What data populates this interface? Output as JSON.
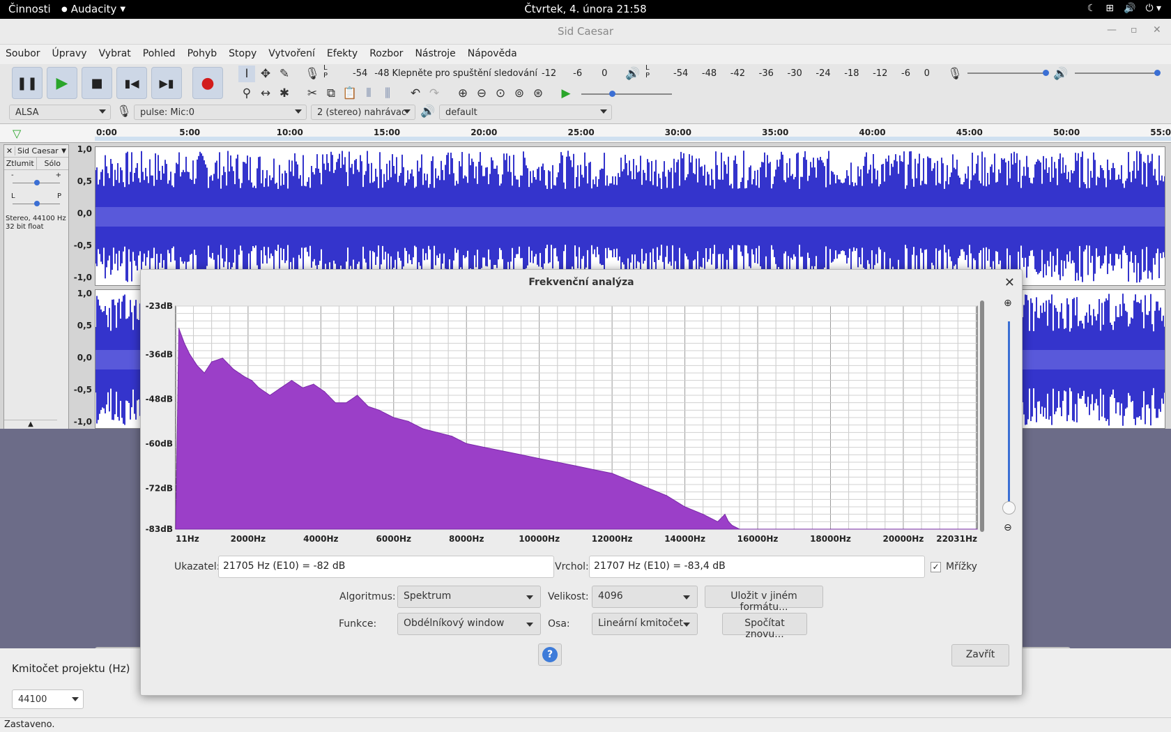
{
  "system": {
    "activities": "Činnosti",
    "app_menu": "Audacity",
    "clock": "Čtvrtek, 4. února  21:58"
  },
  "window": {
    "title": "Sid Caesar"
  },
  "menu": [
    "Soubor",
    "Úpravy",
    "Vybrat",
    "Pohled",
    "Pohyb",
    "Stopy",
    "Vytvoření",
    "Efekty",
    "Rozbor",
    "Nástroje",
    "Nápověda"
  ],
  "meters": {
    "record_left": "L",
    "record_right": "P",
    "record_ticks": [
      "-54",
      "-48"
    ],
    "record_hint": "Klepněte pro spuštění sledování",
    "record_ticks2": [
      "-12",
      "-6",
      "0"
    ],
    "play_left": "L",
    "play_right": "P",
    "play_ticks": [
      "-54",
      "-48",
      "-42",
      "-36",
      "-30",
      "-24",
      "-18",
      "-12",
      "-6",
      "0"
    ]
  },
  "devices": {
    "host": "ALSA",
    "input": "pulse: Mic:0",
    "channels": "2 (stereo) nahrávac",
    "output": "default"
  },
  "ruler": [
    "0:00",
    "5:00",
    "10:00",
    "15:00",
    "20:00",
    "25:00",
    "30:00",
    "35:00",
    "40:00",
    "45:00",
    "50:00",
    "55:00"
  ],
  "track": {
    "name": "Sid Caesar",
    "mute": "Ztlumit",
    "solo": "Sólo",
    "gain_minus": "-",
    "gain_plus": "+",
    "pan_left": "L",
    "pan_right": "P",
    "format_line1": "Stereo, 44100 Hz",
    "format_line2": "32 bit float",
    "scale": [
      "1,0",
      "0,5",
      "0,0",
      "-0,5",
      "-1,0"
    ]
  },
  "selection": {
    "rate_label": "Kmitočet projektu (Hz)",
    "rate_value": "44100"
  },
  "status": "Zastaveno.",
  "dialog": {
    "title": "Frekvenční analýza",
    "y_labels": [
      "-23dB",
      "-36dB",
      "-48dB",
      "-60dB",
      "-72dB",
      "-83dB"
    ],
    "x_labels": [
      "11Hz",
      "2000Hz",
      "4000Hz",
      "6000Hz",
      "8000Hz",
      "10000Hz",
      "12000Hz",
      "14000Hz",
      "16000Hz",
      "18000Hz",
      "20000Hz",
      "22031Hz"
    ],
    "cursor_label": "Ukazatel:",
    "cursor_value": "21705 Hz (E10) = -82 dB",
    "peak_label": "Vrchol:",
    "peak_value": "21707 Hz (E10) = -83,4 dB",
    "grids_label": "Mřížky",
    "algorithm_label": "Algoritmus:",
    "algorithm_value": "Spektrum",
    "size_label": "Velikost:",
    "size_value": "4096",
    "export_button": "Uložit v jiném formátu...",
    "function_label": "Funkce:",
    "function_value": "Obdélníkový window",
    "axis_label": "Osa:",
    "axis_value": "Lineární kmitočet",
    "replot_button": "Spočítat znovu...",
    "help_button": "?",
    "close_button": "Zavřít"
  },
  "chart_data": {
    "type": "area",
    "xlabel": "",
    "ylabel": "",
    "xlim": [
      11,
      22031
    ],
    "ylim": [
      -83,
      -23
    ],
    "x_ticks": [
      "11Hz",
      "2000Hz",
      "4000Hz",
      "6000Hz",
      "8000Hz",
      "10000Hz",
      "12000Hz",
      "14000Hz",
      "16000Hz",
      "18000Hz",
      "20000Hz",
      "22031Hz"
    ],
    "y_ticks": [
      "-23dB",
      "-36dB",
      "-48dB",
      "-60dB",
      "-72dB",
      "-83dB"
    ],
    "grid": true,
    "series": [
      {
        "color": "#9b3fc8",
        "x": [
          11,
          100,
          250,
          400,
          600,
          800,
          1000,
          1300,
          1600,
          1900,
          2100,
          2300,
          2600,
          2900,
          3200,
          3500,
          3800,
          4100,
          4400,
          4700,
          5000,
          5300,
          5600,
          6000,
          6400,
          6800,
          7200,
          7600,
          8000,
          8500,
          9000,
          9500,
          10000,
          10500,
          11000,
          11500,
          12000,
          12500,
          13000,
          13500,
          14000,
          14500,
          14900,
          15100,
          15200,
          15300,
          15500,
          16000,
          17000,
          18000,
          22031
        ],
        "y": [
          -83,
          -29,
          -33,
          -36,
          -39,
          -41,
          -38,
          -37,
          -40,
          -42,
          -43,
          -45,
          -47,
          -45,
          -43,
          -45,
          -44,
          -46,
          -49,
          -49,
          -47,
          -50,
          -51,
          -53,
          -54,
          -56,
          -57,
          -58,
          -60,
          -61,
          -62,
          -63,
          -64,
          -65,
          -66,
          -67,
          -68,
          -70,
          -72,
          -74,
          -77,
          -79,
          -81,
          -79,
          -81,
          -82,
          -83,
          -83,
          -83,
          -83,
          -83
        ]
      }
    ]
  }
}
